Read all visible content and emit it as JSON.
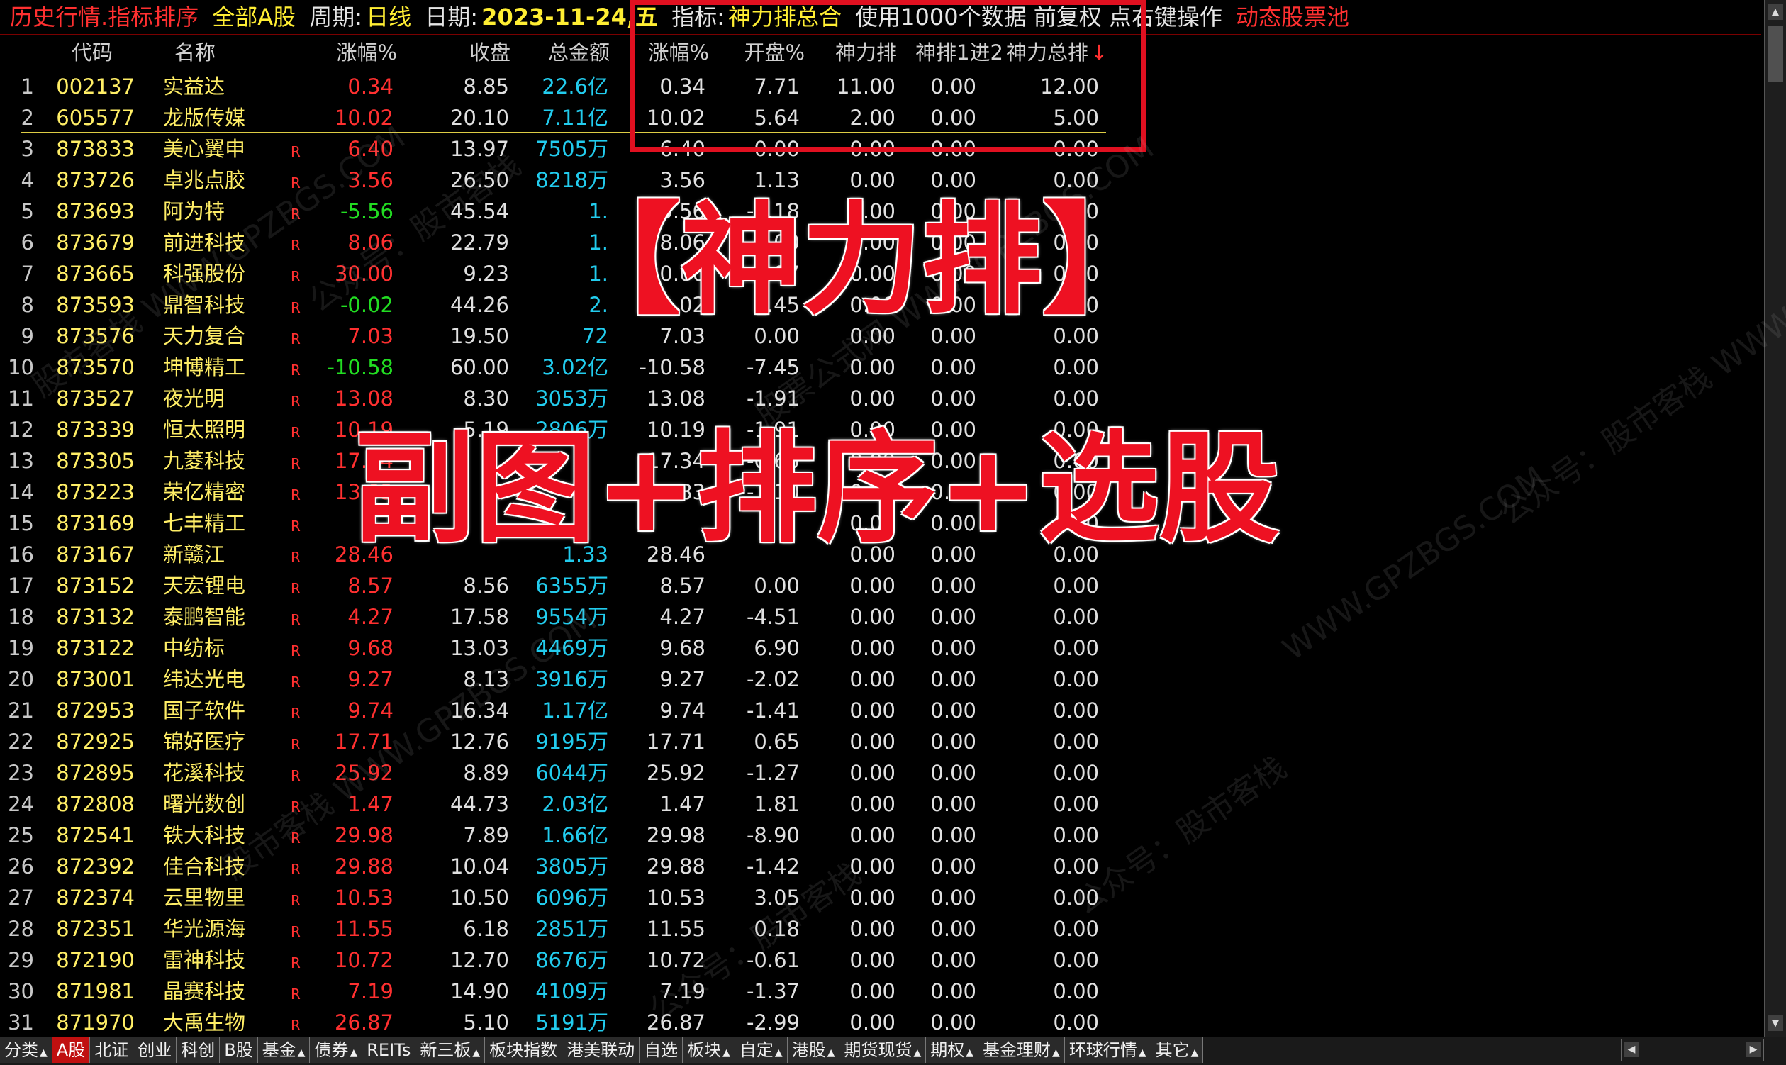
{
  "top_bar": {
    "mode": "历史行情.指标排序",
    "market": "全部A股",
    "period_label": "周期:",
    "period_value": "日线",
    "date_label": "日期:",
    "date_value": "2023-11-24,五",
    "indicator_label": "指标:",
    "indicator_value": "神力排总合",
    "data_note": "使用1000个数据 前复权 点右键操作",
    "pool": "动态股票池"
  },
  "columns": {
    "code": "代码",
    "name": "名称",
    "change": "涨幅%",
    "close": "收盘",
    "amount": "总金额",
    "ind_change": "涨幅%",
    "open_pct": "开盘%",
    "shenli_rank": "神力排",
    "shenpai_1to2": "神排1进2",
    "shenli_total": "神力总排",
    "sort_arrow": "↓"
  },
  "rows": [
    {
      "n": "1",
      "code": "002137",
      "name": "实益达",
      "flag": "",
      "chg": "0.34",
      "dir": "up",
      "close": "8.85",
      "amt": "22.6亿",
      "ic": "0.34",
      "op": "7.71",
      "r1": "11.00",
      "r2": "0.00",
      "r3": "12.00"
    },
    {
      "n": "2",
      "code": "605577",
      "name": "龙版传媒",
      "flag": "",
      "chg": "10.02",
      "dir": "up",
      "close": "20.10",
      "amt": "7.11亿",
      "ic": "10.02",
      "op": "5.64",
      "r1": "2.00",
      "r2": "0.00",
      "r3": "5.00"
    },
    {
      "n": "3",
      "code": "873833",
      "name": "美心翼申",
      "flag": "R",
      "chg": "6.40",
      "dir": "up",
      "close": "13.97",
      "amt": "7505万",
      "ic": "6.40",
      "op": "0.00",
      "r1": "0.00",
      "r2": "0.00",
      "r3": "0.00"
    },
    {
      "n": "4",
      "code": "873726",
      "name": "卓兆点胶",
      "flag": "R",
      "chg": "3.56",
      "dir": "up",
      "close": "26.50",
      "amt": "8218万",
      "ic": "3.56",
      "op": "1.13",
      "r1": "0.00",
      "r2": "0.00",
      "r3": "0.00"
    },
    {
      "n": "5",
      "code": "873693",
      "name": "阿为特",
      "flag": "R",
      "chg": "-5.56",
      "dir": "down",
      "close": "45.54",
      "amt": "1.",
      "ic": "-5.56",
      "op": "-1.18",
      "r1": "0.00",
      "r2": "0.00",
      "r3": "0.00"
    },
    {
      "n": "6",
      "code": "873679",
      "name": "前进科技",
      "flag": "R",
      "chg": "8.06",
      "dir": "up",
      "close": "22.79",
      "amt": "1.",
      "ic": "8.06",
      "op": "0.00",
      "r1": "0.00",
      "r2": "0.00",
      "r3": "0.00"
    },
    {
      "n": "7",
      "code": "873665",
      "name": "科强股份",
      "flag": "R",
      "chg": "30.00",
      "dir": "up",
      "close": "9.23",
      "amt": "1.",
      "ic": "30.00",
      "op": "0.97",
      "r1": "0.00",
      "r2": "0.00",
      "r3": "0.00"
    },
    {
      "n": "8",
      "code": "873593",
      "name": "鼎智科技",
      "flag": "R",
      "chg": "-0.02",
      "dir": "down",
      "close": "44.26",
      "amt": "2.",
      "ic": "-0.02",
      "op": "0.45",
      "r1": "0.00",
      "r2": "0.00",
      "r3": "0.00"
    },
    {
      "n": "9",
      "code": "873576",
      "name": "天力复合",
      "flag": "R",
      "chg": "7.03",
      "dir": "up",
      "close": "19.50",
      "amt": "72",
      "ic": "7.03",
      "op": "0.00",
      "r1": "0.00",
      "r2": "0.00",
      "r3": "0.00"
    },
    {
      "n": "10",
      "code": "873570",
      "name": "坤博精工",
      "flag": "R",
      "chg": "-10.58",
      "dir": "down",
      "close": "60.00",
      "amt": "3.02亿",
      "ic": "-10.58",
      "op": "-7.45",
      "r1": "0.00",
      "r2": "0.00",
      "r3": "0.00"
    },
    {
      "n": "11",
      "code": "873527",
      "name": "夜光明",
      "flag": "R",
      "chg": "13.08",
      "dir": "up",
      "close": "8.30",
      "amt": "3053万",
      "ic": "13.08",
      "op": "-1.91",
      "r1": "0.00",
      "r2": "0.00",
      "r3": "0.00"
    },
    {
      "n": "12",
      "code": "873339",
      "name": "恒太照明",
      "flag": "R",
      "chg": "10.19",
      "dir": "up",
      "close": "5.19",
      "amt": "2806万",
      "ic": "10.19",
      "op": "-1.91",
      "r1": "0.00",
      "r2": "0.00",
      "r3": "0.00"
    },
    {
      "n": "13",
      "code": "873305",
      "name": "九菱科技",
      "flag": "R",
      "chg": "17.34",
      "dir": "up",
      "close": "",
      "amt": "",
      "ic": "17.34",
      "op": "-0.60",
      "r1": "0.00",
      "r2": "0.00",
      "r3": "0.00"
    },
    {
      "n": "14",
      "code": "873223",
      "name": "荣亿精密",
      "flag": "R",
      "chg": "13.83",
      "dir": "up",
      "close": "",
      "amt": "",
      "ic": "13.83",
      "op": "-1.10",
      "r1": "0.00",
      "r2": "0.00",
      "r3": "0.00"
    },
    {
      "n": "15",
      "code": "873169",
      "name": "七丰精工",
      "flag": "R",
      "chg": "",
      "dir": "up",
      "close": "",
      "amt": "",
      "ic": "",
      "op": "",
      "r1": "0.00",
      "r2": "0.00",
      "r3": "0.00"
    },
    {
      "n": "16",
      "code": "873167",
      "name": "新赣江",
      "flag": "R",
      "chg": "28.46",
      "dir": "up",
      "close": "",
      "amt": "1.33",
      "ic": "28.46",
      "op": "",
      "r1": "0.00",
      "r2": "0.00",
      "r3": "0.00"
    },
    {
      "n": "17",
      "code": "873152",
      "name": "天宏锂电",
      "flag": "R",
      "chg": "8.57",
      "dir": "up",
      "close": "8.56",
      "amt": "6355万",
      "ic": "8.57",
      "op": "0.00",
      "r1": "0.00",
      "r2": "0.00",
      "r3": "0.00"
    },
    {
      "n": "18",
      "code": "873132",
      "name": "泰鹏智能",
      "flag": "R",
      "chg": "4.27",
      "dir": "up",
      "close": "17.58",
      "amt": "9554万",
      "ic": "4.27",
      "op": "-4.51",
      "r1": "0.00",
      "r2": "0.00",
      "r3": "0.00"
    },
    {
      "n": "19",
      "code": "873122",
      "name": "中纺标",
      "flag": "R",
      "chg": "9.68",
      "dir": "up",
      "close": "13.03",
      "amt": "4469万",
      "ic": "9.68",
      "op": "6.90",
      "r1": "0.00",
      "r2": "0.00",
      "r3": "0.00"
    },
    {
      "n": "20",
      "code": "873001",
      "name": "纬达光电",
      "flag": "R",
      "chg": "9.27",
      "dir": "up",
      "close": "8.13",
      "amt": "3916万",
      "ic": "9.27",
      "op": "-2.02",
      "r1": "0.00",
      "r2": "0.00",
      "r3": "0.00"
    },
    {
      "n": "21",
      "code": "872953",
      "name": "国子软件",
      "flag": "R",
      "chg": "9.74",
      "dir": "up",
      "close": "16.34",
      "amt": "1.17亿",
      "ic": "9.74",
      "op": "-1.41",
      "r1": "0.00",
      "r2": "0.00",
      "r3": "0.00"
    },
    {
      "n": "22",
      "code": "872925",
      "name": "锦好医疗",
      "flag": "R",
      "chg": "17.71",
      "dir": "up",
      "close": "12.76",
      "amt": "9195万",
      "ic": "17.71",
      "op": "0.65",
      "r1": "0.00",
      "r2": "0.00",
      "r3": "0.00"
    },
    {
      "n": "23",
      "code": "872895",
      "name": "花溪科技",
      "flag": "R",
      "chg": "25.92",
      "dir": "up",
      "close": "8.89",
      "amt": "6044万",
      "ic": "25.92",
      "op": "-1.27",
      "r1": "0.00",
      "r2": "0.00",
      "r3": "0.00"
    },
    {
      "n": "24",
      "code": "872808",
      "name": "曙光数创",
      "flag": "R",
      "chg": "1.47",
      "dir": "up",
      "close": "44.73",
      "amt": "2.03亿",
      "ic": "1.47",
      "op": "1.81",
      "r1": "0.00",
      "r2": "0.00",
      "r3": "0.00"
    },
    {
      "n": "25",
      "code": "872541",
      "name": "铁大科技",
      "flag": "R",
      "chg": "29.98",
      "dir": "up",
      "close": "7.89",
      "amt": "1.66亿",
      "ic": "29.98",
      "op": "-8.90",
      "r1": "0.00",
      "r2": "0.00",
      "r3": "0.00"
    },
    {
      "n": "26",
      "code": "872392",
      "name": "佳合科技",
      "flag": "R",
      "chg": "29.88",
      "dir": "up",
      "close": "10.04",
      "amt": "3805万",
      "ic": "29.88",
      "op": "-1.42",
      "r1": "0.00",
      "r2": "0.00",
      "r3": "0.00"
    },
    {
      "n": "27",
      "code": "872374",
      "name": "云里物里",
      "flag": "R",
      "chg": "10.53",
      "dir": "up",
      "close": "10.50",
      "amt": "6096万",
      "ic": "10.53",
      "op": "3.05",
      "r1": "0.00",
      "r2": "0.00",
      "r3": "0.00"
    },
    {
      "n": "28",
      "code": "872351",
      "name": "华光源海",
      "flag": "R",
      "chg": "11.55",
      "dir": "up",
      "close": "6.18",
      "amt": "2851万",
      "ic": "11.55",
      "op": "0.18",
      "r1": "0.00",
      "r2": "0.00",
      "r3": "0.00"
    },
    {
      "n": "29",
      "code": "872190",
      "name": "雷神科技",
      "flag": "R",
      "chg": "10.72",
      "dir": "up",
      "close": "12.70",
      "amt": "8676万",
      "ic": "10.72",
      "op": "-0.61",
      "r1": "0.00",
      "r2": "0.00",
      "r3": "0.00"
    },
    {
      "n": "30",
      "code": "871981",
      "name": "晶赛科技",
      "flag": "R",
      "chg": "7.19",
      "dir": "up",
      "close": "14.90",
      "amt": "4109万",
      "ic": "7.19",
      "op": "-1.37",
      "r1": "0.00",
      "r2": "0.00",
      "r3": "0.00"
    },
    {
      "n": "31",
      "code": "871970",
      "name": "大禹生物",
      "flag": "R",
      "chg": "26.87",
      "dir": "up",
      "close": "5.10",
      "amt": "5191万",
      "ic": "26.87",
      "op": "-2.99",
      "r1": "0.00",
      "r2": "0.00",
      "r3": "0.00"
    }
  ],
  "overlay": {
    "line1": "【神力排】",
    "line2": "副图+排序+选股"
  },
  "watermarks": [
    "股市客栈 WWW.GPZBGS.COM",
    "公众号：股市客栈",
    "股票公式网 WWW.GPZBGS.COM",
    "公众号：股市客栈",
    "WWW.GPZBGS.COM",
    "公众号：股市客栈 WWW.GPZBGS.COM"
  ],
  "bottom_tabs": [
    {
      "label": "分类",
      "tri": "▲",
      "active": false
    },
    {
      "label": "A股",
      "tri": "",
      "active": true
    },
    {
      "label": "北证",
      "tri": "",
      "active": false
    },
    {
      "label": "创业",
      "tri": "",
      "active": false
    },
    {
      "label": "科创",
      "tri": "",
      "active": false
    },
    {
      "label": "B股",
      "tri": "",
      "active": false
    },
    {
      "label": "基金",
      "tri": "▲",
      "active": false
    },
    {
      "label": "债券",
      "tri": "▲",
      "active": false
    },
    {
      "label": "REITs",
      "tri": "",
      "active": false
    },
    {
      "label": "新三板",
      "tri": "▲",
      "active": false
    },
    {
      "label": "板块指数",
      "tri": "",
      "active": false
    },
    {
      "label": "港美联动",
      "tri": "",
      "active": false
    },
    {
      "label": "自选",
      "tri": "",
      "active": false
    },
    {
      "label": "板块",
      "tri": "▲",
      "active": false
    },
    {
      "label": "自定",
      "tri": "▲",
      "active": false
    },
    {
      "label": "港股",
      "tri": "▲",
      "active": false
    },
    {
      "label": "期货现货",
      "tri": "▲",
      "active": false
    },
    {
      "label": "期权",
      "tri": "▲",
      "active": false
    },
    {
      "label": "基金理财",
      "tri": "▲",
      "active": false
    },
    {
      "label": "环球行情",
      "tri": "▲",
      "active": false
    },
    {
      "label": "其它",
      "tri": "▲",
      "active": false
    }
  ],
  "colors": {
    "up": "#ff3030",
    "down": "#22dd22",
    "amount": "#22ccee",
    "code": "#ffee66",
    "box": "#e01020"
  }
}
